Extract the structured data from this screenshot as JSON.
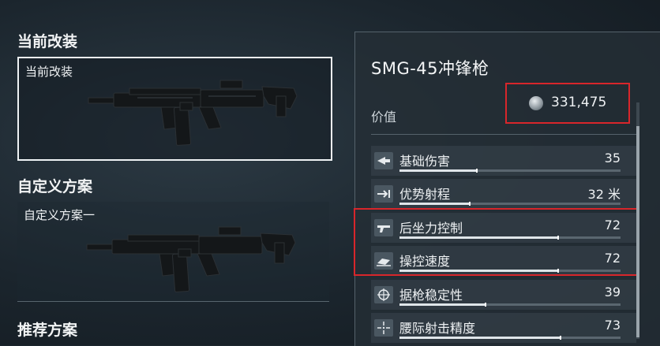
{
  "sections": {
    "current_title": "当前改装",
    "custom_title": "自定义方案",
    "recommended_title": "推荐方案"
  },
  "cards": {
    "current_label": "当前改装",
    "custom_label": "自定义方案一"
  },
  "weapon": {
    "name": "SMG-45冲锋枪",
    "value_label": "价值",
    "value": "331,475",
    "coin_icon": "silver-coin-icon"
  },
  "stats": [
    {
      "label": "基础伤害",
      "value": "35",
      "fill": 0.35,
      "icon": "damage-icon"
    },
    {
      "label": "优势射程",
      "value": "32 米",
      "fill": 0.32,
      "icon": "range-icon"
    },
    {
      "label": "后坐力控制",
      "value": "72",
      "fill": 0.72,
      "icon": "recoil-icon"
    },
    {
      "label": "操控速度",
      "value": "72",
      "fill": 0.72,
      "icon": "handling-icon"
    },
    {
      "label": "据枪稳定性",
      "value": "39",
      "fill": 0.39,
      "icon": "stability-icon"
    },
    {
      "label": "腰际射击精度",
      "value": "73",
      "fill": 0.73,
      "icon": "hipfire-icon"
    }
  ],
  "colors": {
    "highlight": "#d8262b",
    "accent": "#dfe5e9"
  }
}
